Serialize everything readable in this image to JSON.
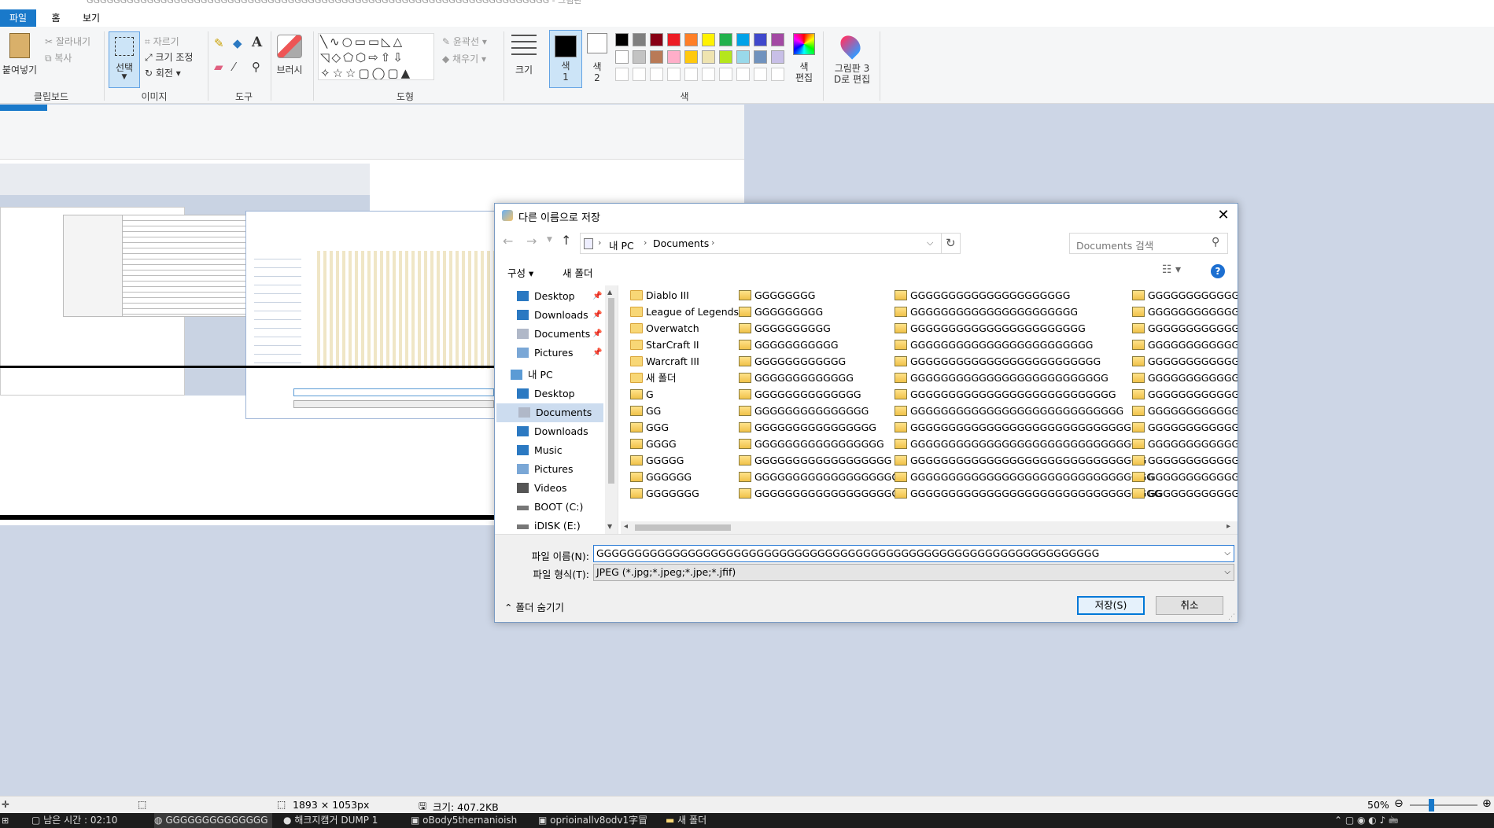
{
  "window": {
    "title": "GGGGGGGGGGGGGGGGGGGGGGGGGGGGGGGGGGGGGGGGGGGGGGGGGGGGGGGGGGGGGGGGGGGGG - 그림판"
  },
  "tabs": [
    "파일",
    "홈",
    "보기"
  ],
  "ribbon": {
    "clipboard": {
      "paste": "붙여넣기",
      "cut": "잘라내기",
      "copy": "복사",
      "group": "클립보드"
    },
    "image": {
      "select": "선택",
      "crop": "자르기",
      "resize": "크기 조정",
      "rotate": "회전",
      "group": "이미지"
    },
    "tools": {
      "group": "도구"
    },
    "brush": "브러시",
    "shapes": {
      "outline": "윤곽선",
      "fill": "채우기",
      "group": "도형"
    },
    "size": "크기",
    "color1": "색\n1",
    "color2": "색\n2",
    "edit_colors": "색\n편집",
    "paint3d": "그림판 3\nD로 편집",
    "colors_group": "색",
    "palette_row1": [
      "#000000",
      "#7f7f7f",
      "#880015",
      "#ed1c24",
      "#ff7f27",
      "#fff200",
      "#22b14c",
      "#00a2e8",
      "#3f48cc",
      "#a349a4"
    ],
    "palette_row2": [
      "#ffffff",
      "#c3c3c3",
      "#b97a57",
      "#ffaec9",
      "#ffc90e",
      "#efe4b0",
      "#b5e61d",
      "#99d9ea",
      "#7092be",
      "#c8bfe7"
    ]
  },
  "dialog": {
    "title": "다른 이름으로 저장",
    "breadcrumb": [
      "내 PC",
      "Documents"
    ],
    "search_placeholder": "Documents 검색",
    "organize": "구성",
    "new_folder": "새 폴더",
    "nav_items": [
      {
        "label": "Desktop",
        "icon": "desktop-icon",
        "pinned": true
      },
      {
        "label": "Downloads",
        "icon": "downloads-icon",
        "pinned": true
      },
      {
        "label": "Documents",
        "icon": "documents-icon",
        "pinned": true
      },
      {
        "label": "Pictures",
        "icon": "pictures-icon",
        "pinned": true
      },
      {
        "label": "내 PC",
        "icon": "pc-icon",
        "pinned": false
      },
      {
        "label": "Desktop",
        "icon": "desktop-icon",
        "pinned": false
      },
      {
        "label": "Documents",
        "icon": "documents-icon",
        "pinned": false,
        "selected": true
      },
      {
        "label": "Downloads",
        "icon": "downloads-icon",
        "pinned": false
      },
      {
        "label": "Music",
        "icon": "music-icon",
        "pinned": false
      },
      {
        "label": "Pictures",
        "icon": "pictures-icon",
        "pinned": false
      },
      {
        "label": "Videos",
        "icon": "videos-icon",
        "pinned": false
      },
      {
        "label": "BOOT (C:)",
        "icon": "drive-icon",
        "pinned": false
      },
      {
        "label": "iDISK (E:)",
        "icon": "drive-icon",
        "pinned": false
      }
    ],
    "files_col1": [
      {
        "name": "Diablo III",
        "type": "folder"
      },
      {
        "name": "League of Legends",
        "type": "folder"
      },
      {
        "name": "Overwatch",
        "type": "folder"
      },
      {
        "name": "StarCraft II",
        "type": "folder"
      },
      {
        "name": "Warcraft III",
        "type": "folder"
      },
      {
        "name": "새 폴더",
        "type": "folder"
      },
      {
        "name": "G",
        "type": "image"
      },
      {
        "name": "GG",
        "type": "image"
      },
      {
        "name": "GGG",
        "type": "image"
      },
      {
        "name": "GGGG",
        "type": "image"
      },
      {
        "name": "GGGGG",
        "type": "image"
      },
      {
        "name": "GGGGGG",
        "type": "image"
      },
      {
        "name": "GGGGGGG",
        "type": "image"
      }
    ],
    "files_col2": [
      "GGGGGGGG",
      "GGGGGGGGG",
      "GGGGGGGGGG",
      "GGGGGGGGGGG",
      "GGGGGGGGGGGG",
      "GGGGGGGGGGGGG",
      "GGGGGGGGGGGGGG",
      "GGGGGGGGGGGGGGG",
      "GGGGGGGGGGGGGGGG",
      "GGGGGGGGGGGGGGGGG",
      "GGGGGGGGGGGGGGGGGG",
      "GGGGGGGGGGGGGGGGGGG",
      "GGGGGGGGGGGGGGGGGGGG"
    ],
    "files_col3": [
      "GGGGGGGGGGGGGGGGGGGGG",
      "GGGGGGGGGGGGGGGGGGGGGG",
      "GGGGGGGGGGGGGGGGGGGGGGG",
      "GGGGGGGGGGGGGGGGGGGGGGGG",
      "GGGGGGGGGGGGGGGGGGGGGGGGG",
      "GGGGGGGGGGGGGGGGGGGGGGGGGG",
      "GGGGGGGGGGGGGGGGGGGGGGGGGGG",
      "GGGGGGGGGGGGGGGGGGGGGGGGGGGG",
      "GGGGGGGGGGGGGGGGGGGGGGGGGGGGG",
      "GGGGGGGGGGGGGGGGGGGGGGGGGGGGGG",
      "GGGGGGGGGGGGGGGGGGGGGGGGGGGGGGG",
      "GGGGGGGGGGGGGGGGGGGGGGGGGGGGGGGG",
      "GGGGGGGGGGGGGGGGGGGGGGGGGGGGGGGGG"
    ],
    "files_col4": [
      "GGGGGGGGGGGGG",
      "GGGGGGGGGGGGG",
      "GGGGGGGGGGGGG",
      "GGGGGGGGGGGGG",
      "GGGGGGGGGGGGG",
      "GGGGGGGGGGGGG",
      "GGGGGGGGGGGGG",
      "GGGGGGGGGGGGG",
      "GGGGGGGGGGGGG",
      "GGGGGGGGGGGGG",
      "GGGGGGGGGGGGG",
      "GGGGGGGGGGGGG",
      "GGGGGGGGGGGGG"
    ],
    "filename_label": "파일 이름(N):",
    "filename_value": "GGGGGGGGGGGGGGGGGGGGGGGGGGGGGGGGGGGGGGGGGGGGGGGGGGGGGGGGGGGGGGGGGG",
    "filetype_label": "파일 형식(T):",
    "filetype_value": "JPEG (*.jpg;*.jpeg;*.jpe;*.jfif)",
    "hide_folders": "폴더 숨기기",
    "save": "저장(S)",
    "cancel": "취소"
  },
  "status": {
    "dimensions": "1893 × 1053px",
    "size": "크기: 407.2KB",
    "zoom": "50%"
  },
  "taskbar": [
    "남은 시간 : 02:10",
    "GGGGGGGGGGGGGG",
    "해크지캠거 DUMP 1",
    "oBody5thernanioish",
    "oprioinallv8odv1字冒",
    "새 폴더"
  ]
}
